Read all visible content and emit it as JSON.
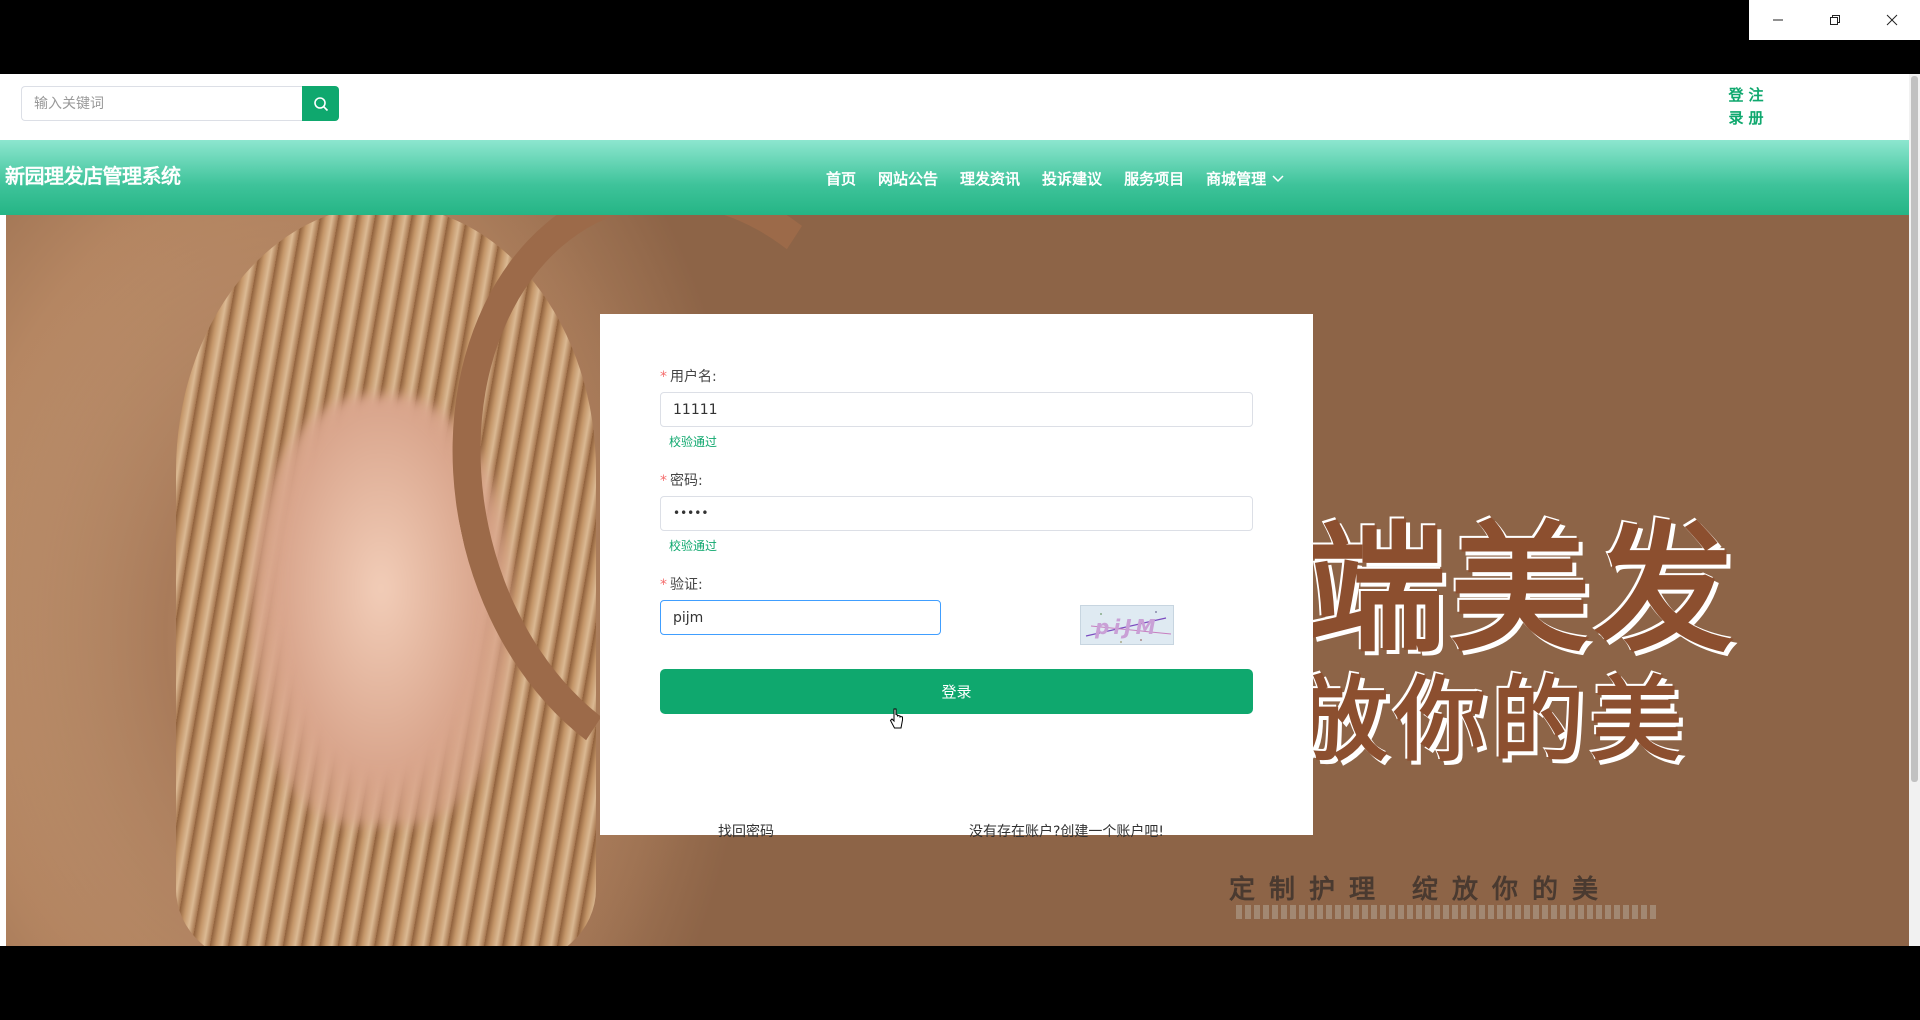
{
  "window": {
    "controls": [
      "minimize-icon",
      "restore-icon",
      "close-icon"
    ]
  },
  "topbar": {
    "search_placeholder": "输入关键词",
    "search_icon": "search-icon",
    "login_label": "登录",
    "register_label": "注册"
  },
  "nav": {
    "site_title": "新园理发店管理系统",
    "items": [
      {
        "label": "首页"
      },
      {
        "label": "网站公告"
      },
      {
        "label": "理发资讯"
      },
      {
        "label": "投诉建议"
      },
      {
        "label": "服务项目"
      },
      {
        "label": "商城管理",
        "dropdown": true
      }
    ]
  },
  "banner": {
    "line1": "端美发",
    "line2": "放你的美",
    "sub": "定制护理  绽放你的美"
  },
  "login": {
    "username_label": "用户名:",
    "username_value": "11111",
    "username_status": "校验通过",
    "password_label": "密码:",
    "password_value": "•••••",
    "password_status": "校验通过",
    "captcha_label": "验证:",
    "captcha_value": "pijm",
    "captcha_image_text": "piJM",
    "submit_label": "登录",
    "forgot_label": "找回密码",
    "register_label": "没有存在账户?创建一个账户吧!"
  },
  "colors": {
    "accent": "#0fa86e",
    "required": "#f56c6c",
    "focus": "#409eff"
  }
}
